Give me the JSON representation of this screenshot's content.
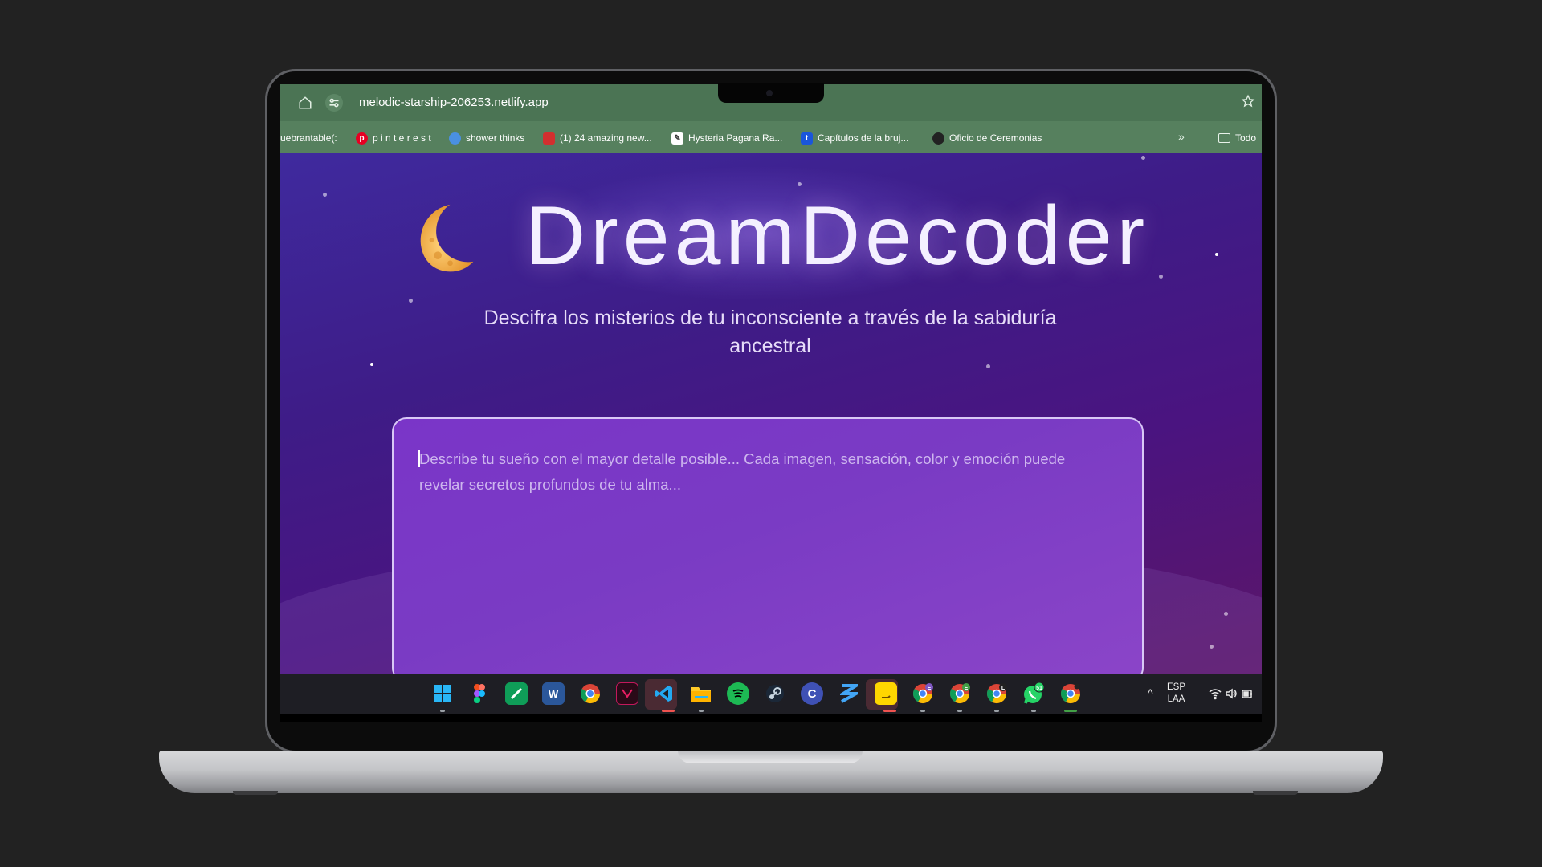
{
  "browser": {
    "url": "melodic-starship-206253.netlify.app",
    "bookmarks": [
      {
        "label": "uebrantable(:",
        "icon": "none"
      },
      {
        "label": "p i n t e r e s t",
        "icon": "pinterest-icon",
        "color": "#e60023"
      },
      {
        "label": "shower thinks",
        "icon": "globe-icon",
        "color": "#4a90e2"
      },
      {
        "label": "(1) 24 amazing new...",
        "icon": "gift-icon",
        "color": "#d32f2f"
      },
      {
        "label": "Hysteria Pagana Ra...",
        "icon": "page-icon",
        "color": "#ffffff"
      },
      {
        "label": "Capítulos de la bruj...",
        "icon": "t-logo-icon",
        "color": "#1a56db"
      },
      {
        "label": "Oficio de Ceremonias",
        "icon": "site-icon",
        "color": "#222222"
      }
    ],
    "bookmarks_more": "»",
    "other_bookmarks_label": "Todo"
  },
  "page": {
    "title": "DreamDecoder",
    "tagline": "Descifra los misterios de tu inconsciente a través de la sabiduría ancestral",
    "dream_input_placeholder": "Describe tu sueño con el mayor detalle posible... Cada imagen, sensación, color y emoción puede revelar secretos profundos de tu alma..."
  },
  "taskbar": {
    "apps": [
      {
        "name": "start-menu-icon",
        "color": "#29b6f6"
      },
      {
        "name": "figma-icon",
        "color": "#f24e1e"
      },
      {
        "name": "sheets-icon",
        "color": "#0f9d58"
      },
      {
        "name": "word-icon",
        "color": "#2b579a",
        "label": "W"
      },
      {
        "name": "chrome-icon",
        "color": "#fbbc04"
      },
      {
        "name": "capcut-icon",
        "color": "#c2185b"
      },
      {
        "name": "vscode-icon",
        "color": "#23a9f2",
        "active": true
      },
      {
        "name": "file-explorer-icon",
        "color": "#ffca28"
      },
      {
        "name": "spotify-icon",
        "color": "#1db954"
      },
      {
        "name": "steam-icon",
        "color": "#1b2838"
      },
      {
        "name": "copilot-icon",
        "color": "#3f51b5",
        "label": "C"
      },
      {
        "name": "app-blue-icon",
        "color": "#1565c0"
      },
      {
        "name": "sticky-notes-icon",
        "color": "#ffd600",
        "active": true
      },
      {
        "name": "chrome-profile-e-icon",
        "color": "#fbbc04",
        "badge": "E",
        "badge_color": "#7e57c2"
      },
      {
        "name": "chrome-profile-e2-icon",
        "color": "#fbbc04",
        "badge": "E",
        "badge_color": "#43a047"
      },
      {
        "name": "chrome-profile-l-icon",
        "color": "#fbbc04",
        "badge": "L",
        "badge_color": "#212121"
      },
      {
        "name": "whatsapp-icon",
        "color": "#25d366",
        "badge": "51",
        "badge_color": "#25d366"
      },
      {
        "name": "chrome-active-icon",
        "color": "#fbbc04",
        "active_indicator": true
      }
    ],
    "lang_top": "ESP",
    "lang_bottom": "LAA"
  }
}
